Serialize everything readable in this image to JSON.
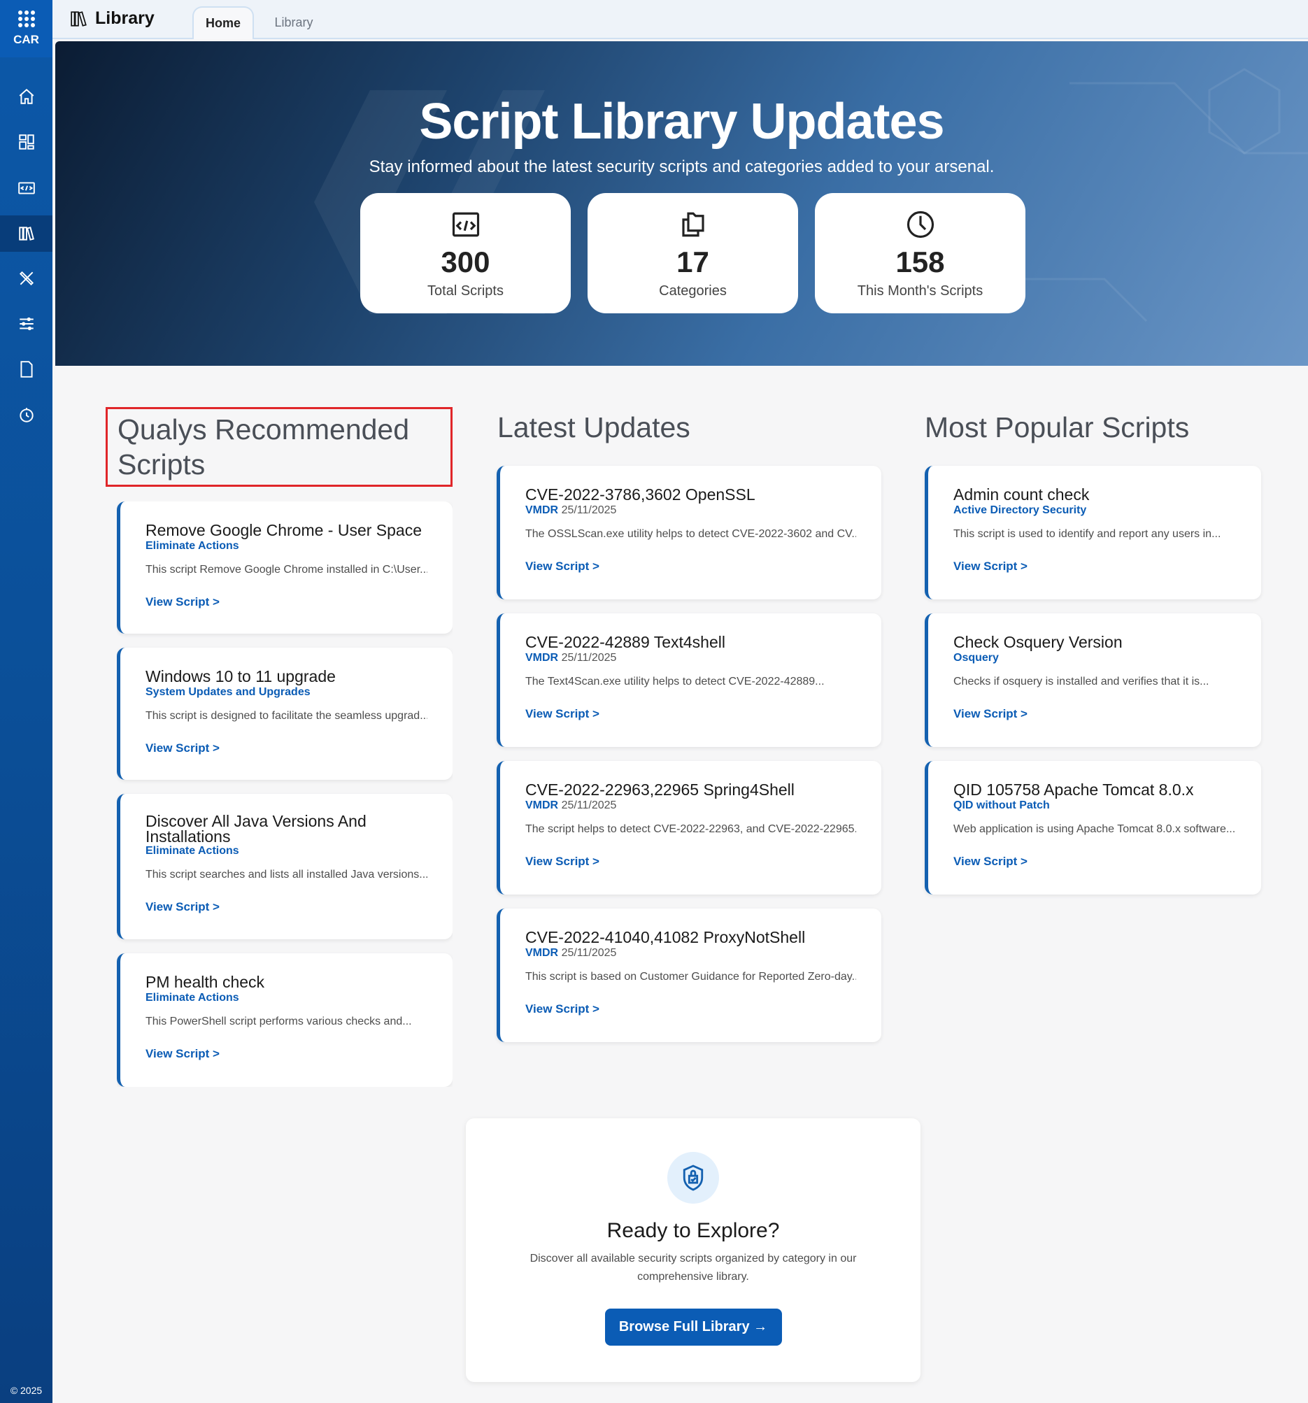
{
  "sidebar": {
    "brand": "CAR",
    "copyright": "© 2025",
    "items": [
      {
        "icon": "home-icon"
      },
      {
        "icon": "dashboard-icon"
      },
      {
        "icon": "code-icon"
      },
      {
        "icon": "library-icon",
        "active": true
      },
      {
        "icon": "tools-icon"
      },
      {
        "icon": "sliders-icon"
      },
      {
        "icon": "document-icon"
      },
      {
        "icon": "history-icon"
      }
    ]
  },
  "header": {
    "title": "Library",
    "tabs": [
      {
        "label": "Home",
        "active": true
      },
      {
        "label": "Library"
      }
    ]
  },
  "hero": {
    "title": "Script Library Updates",
    "subtitle": "Stay informed about the latest security scripts and categories added to your arsenal.",
    "stats": [
      {
        "icon": "code-window-icon",
        "value": "300",
        "label": "Total Scripts"
      },
      {
        "icon": "folders-icon",
        "value": "17",
        "label": "Categories"
      },
      {
        "icon": "clock-icon",
        "value": "158",
        "label": "This Month's Scripts"
      }
    ]
  },
  "recommended": {
    "heading": "Qualys Recommended Scripts",
    "cards": [
      {
        "title": "Remove Google Chrome - User Space",
        "category": "Eliminate Actions",
        "description": "This script Remove Google Chrome installed in C:\\User...",
        "link": "View Script >"
      },
      {
        "title": "Windows 10 to 11 upgrade",
        "category": "System Updates and Upgrades",
        "description": "This script is designed to facilitate the seamless upgrad...",
        "link": "View Script >"
      },
      {
        "title": "Discover All Java Versions And Installations",
        "category": "Eliminate Actions",
        "description": "This script searches and lists all installed Java versions...",
        "link": "View Script >"
      },
      {
        "title": "PM health check",
        "category": "Eliminate Actions",
        "description": "This PowerShell script performs various checks and...",
        "link": "View Script >"
      }
    ]
  },
  "latest": {
    "heading": "Latest Updates",
    "cards": [
      {
        "title": "CVE-2022-3786,3602 OpenSSL",
        "category": "VMDR",
        "date": "25/11/2025",
        "description": "The OSSLScan.exe utility helps to detect CVE-2022-3602 and CV...",
        "link": "View Script >"
      },
      {
        "title": "CVE-2022-42889 Text4shell",
        "category": "VMDR",
        "date": "25/11/2025",
        "description": "The Text4Scan.exe utility helps to detect CVE-2022-42889...",
        "link": "View Script >"
      },
      {
        "title": "CVE-2022-22963,22965 Spring4Shell",
        "category": "VMDR",
        "date": "25/11/2025",
        "description": "The script helps to detect CVE-2022-22963, and CVE-2022-22965...",
        "link": "View Script >"
      },
      {
        "title": "CVE-2022-41040,41082 ProxyNotShell",
        "category": "VMDR",
        "date": "25/11/2025",
        "description": "This script is based on Customer Guidance for Reported Zero-day...",
        "link": "View Script >"
      }
    ]
  },
  "popular": {
    "heading": "Most Popular Scripts",
    "cards": [
      {
        "title": "Admin count check",
        "category": "Active Directory Security",
        "description": "This script is used to identify and report any users in...",
        "link": "View Script >"
      },
      {
        "title": "Check Osquery Version",
        "category": "Osquery",
        "description": "Checks if osquery is installed and verifies that it is...",
        "link": "View Script >"
      },
      {
        "title": "QID 105758 Apache Tomcat 8.0.x",
        "category": "QID without Patch",
        "description": "Web application is using Apache Tomcat 8.0.x software...",
        "link": "View Script >"
      }
    ]
  },
  "cta": {
    "title": "Ready to Explore?",
    "description": "Discover all available security scripts organized by category in our comprehensive library.",
    "button": "Browse Full Library →"
  }
}
